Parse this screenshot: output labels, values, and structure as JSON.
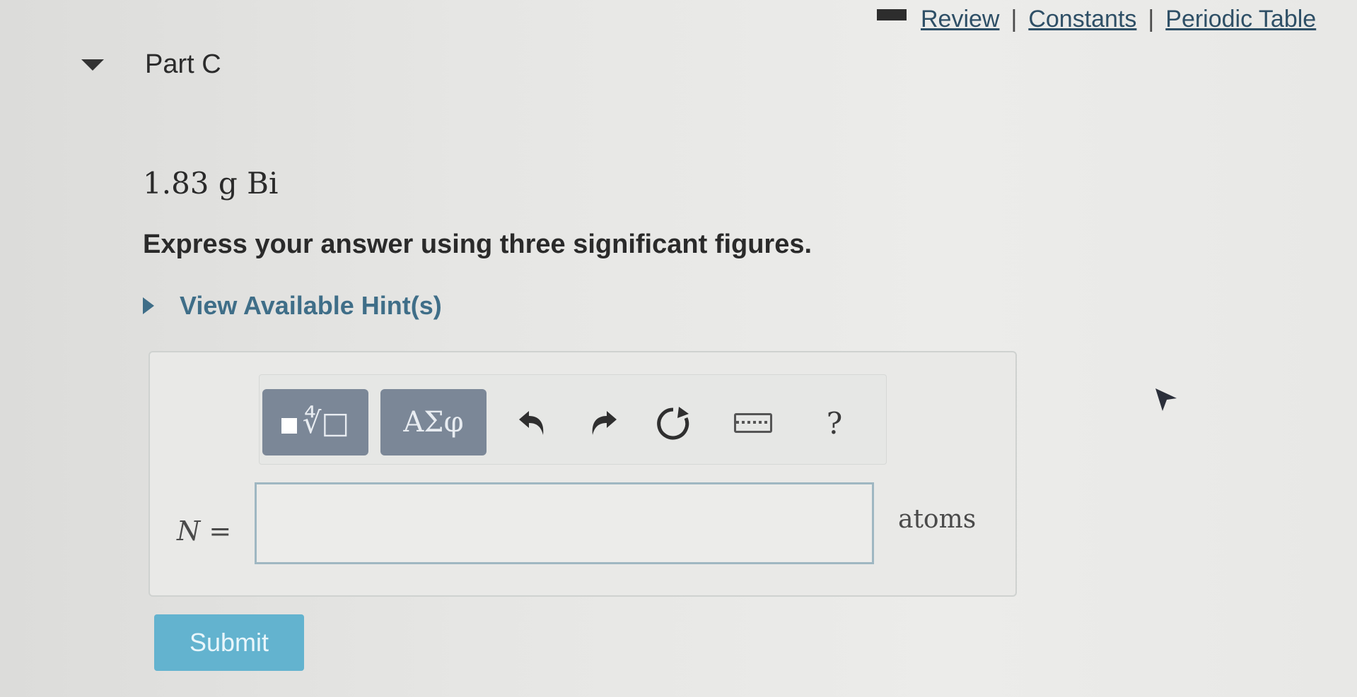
{
  "header": {
    "links": [
      {
        "label": "Review"
      },
      {
        "label": "Constants"
      },
      {
        "label": "Periodic Table"
      }
    ],
    "separator": "|"
  },
  "part": {
    "title": "Part C",
    "quantity": "1.83 g Bi",
    "instruction": "Express your answer using three significant figures.",
    "hints_label": "View Available Hint(s)"
  },
  "toolbar": {
    "greek_label": "ΑΣφ",
    "help_label": "?"
  },
  "answer": {
    "variable": "N =",
    "value": "",
    "units": "atoms"
  },
  "submit": {
    "label": "Submit"
  },
  "colors": {
    "link": "#2e4f66",
    "hint": "#3f6e88",
    "toolbar_button": "#7b8797",
    "submit": "#63b3cf",
    "input_border": "#9fb7c2"
  }
}
